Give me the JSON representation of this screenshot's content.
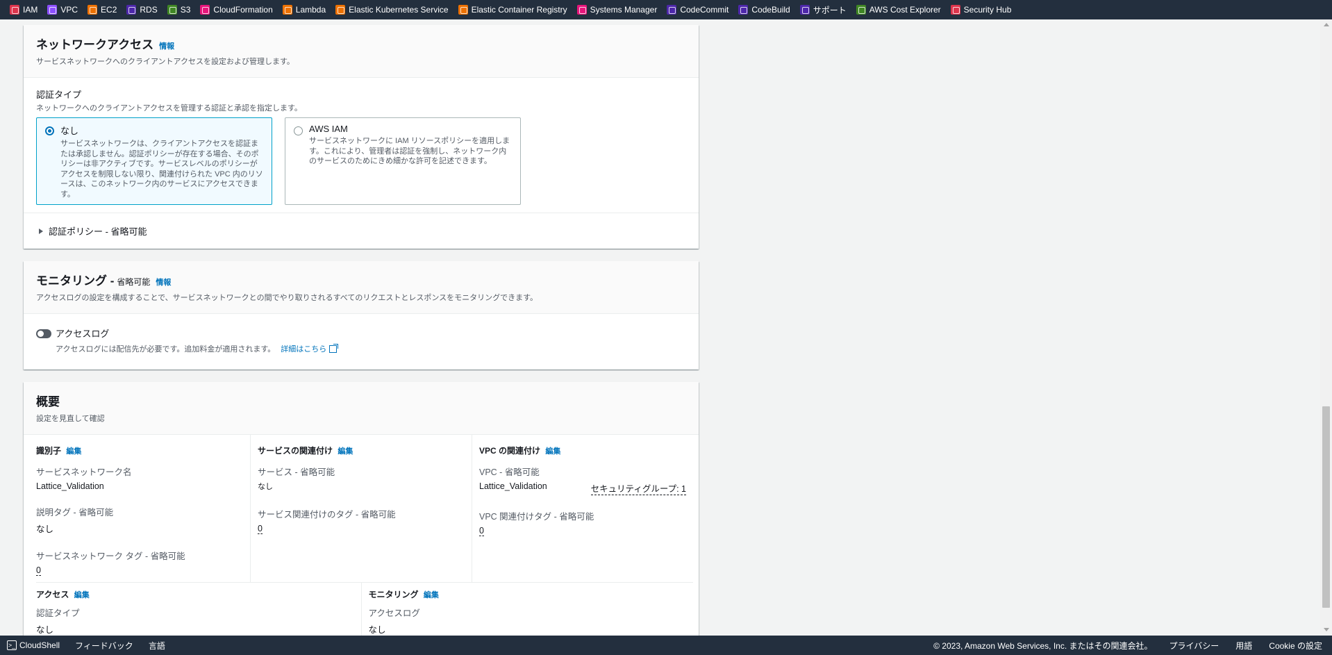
{
  "topbar": {
    "services": [
      {
        "label": "IAM",
        "icon": "iam-icon",
        "color": "#dd344c"
      },
      {
        "label": "VPC",
        "icon": "vpc-icon",
        "color": "#8c4fff"
      },
      {
        "label": "EC2",
        "icon": "ec2-icon",
        "color": "#ed7100"
      },
      {
        "label": "RDS",
        "icon": "rds-icon",
        "color": "#4d27aa"
      },
      {
        "label": "S3",
        "icon": "s3-icon",
        "color": "#3f8624"
      },
      {
        "label": "CloudFormation",
        "icon": "cloudformation-icon",
        "color": "#e7157b"
      },
      {
        "label": "Lambda",
        "icon": "lambda-icon",
        "color": "#ed7100"
      },
      {
        "label": "Elastic Kubernetes Service",
        "icon": "eks-icon",
        "color": "#ed7100"
      },
      {
        "label": "Elastic Container Registry",
        "icon": "ecr-icon",
        "color": "#ed7100"
      },
      {
        "label": "Systems Manager",
        "icon": "systems-manager-icon",
        "color": "#e7157b"
      },
      {
        "label": "CodeCommit",
        "icon": "codecommit-icon",
        "color": "#4d27aa"
      },
      {
        "label": "CodeBuild",
        "icon": "codebuild-icon",
        "color": "#4d27aa"
      },
      {
        "label": "サポート",
        "icon": "support-icon",
        "color": "#4d27aa"
      },
      {
        "label": "AWS Cost Explorer",
        "icon": "cost-explorer-icon",
        "color": "#3f8624"
      },
      {
        "label": "Security Hub",
        "icon": "security-hub-icon",
        "color": "#dd344c"
      }
    ]
  },
  "network_access": {
    "title": "ネットワークアクセス",
    "info": "情報",
    "description": "サービスネットワークへのクライアントアクセスを設定および管理します。",
    "auth_type_label": "認証タイプ",
    "auth_type_desc": "ネットワークへのクライアントアクセスを管理する認証と承認を指定します。",
    "options": [
      {
        "title": "なし",
        "selected": true,
        "description": "サービスネットワークは、クライアントアクセスを認証または承認しません。認証ポリシーが存在する場合、そのポリシーは非アクティブです。サービスレベルのポリシーがアクセスを制限しない限り、関連付けられた VPC 内のリソースは、このネットワーク内のサービスにアクセスできます。"
      },
      {
        "title": "AWS IAM",
        "selected": false,
        "description": "サービスネットワークに IAM リソースポリシーを適用します。これにより、管理者は認証を強制し、ネットワーク内のサービスのためにきめ細かな許可を記述できます。"
      }
    ],
    "policy_expander": "認証ポリシー - 省略可能"
  },
  "monitoring": {
    "title": "モニタリング -",
    "optional": "省略可能",
    "info": "情報",
    "description": "アクセスログの設定を構成することで、サービスネットワークとの間でやり取りされるすべてのリクエストとレスポンスをモニタリングできます。",
    "toggle_label": "アクセスログ",
    "toggle_on": false,
    "toggle_desc": "アクセスログには配信先が必要です。追加料金が適用されます。",
    "learn_more": "詳細はこちら"
  },
  "summary": {
    "title": "概要",
    "description": "設定を見直して確認",
    "edit": "編集",
    "identifier": {
      "heading": "識別子",
      "name_key": "サービスネットワーク名",
      "name_val": "Lattice_Validation",
      "desc_tag_key": "説明タグ - 省略可能",
      "desc_tag_val": "なし",
      "sn_tag_key": "サービスネットワーク タグ - 省略可能",
      "sn_tag_val": "0"
    },
    "service_assoc": {
      "heading": "サービスの関連付け",
      "services_key": "サービス - 省略可能",
      "services_val": "なし",
      "tags_key": "サービス関連付けのタグ - 省略可能",
      "tags_val": "0"
    },
    "vpc_assoc": {
      "heading": "VPC の関連付け",
      "vpc_key": "VPC - 省略可能",
      "vpc_val": "Lattice_Validation",
      "sg_val": "セキュリティグループ: 1",
      "tags_key": "VPC 関連付けタグ - 省略可能",
      "tags_val": "0"
    },
    "access": {
      "heading": "アクセス",
      "auth_key": "認証タイプ",
      "auth_val": "なし"
    },
    "monitoring": {
      "heading": "モニタリング",
      "log_key": "アクセスログ",
      "log_val": "なし"
    }
  },
  "bottombar": {
    "cloudshell": "CloudShell",
    "feedback": "フィードバック",
    "language": "言語",
    "copyright": "© 2023, Amazon Web Services, Inc. またはその関連会社。",
    "privacy": "プライバシー",
    "terms": "用語",
    "cookies": "Cookie の設定"
  }
}
